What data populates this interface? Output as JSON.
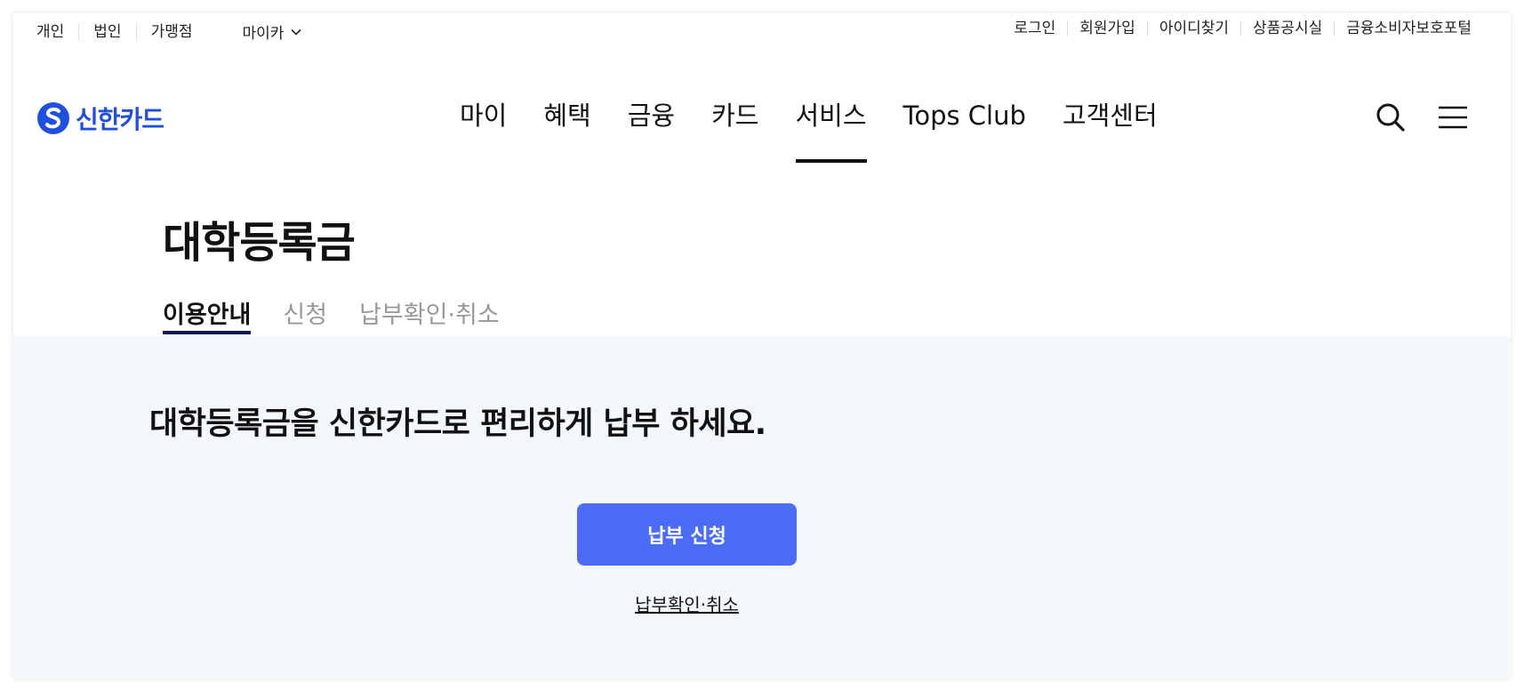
{
  "util": {
    "left": [
      "개인",
      "법인",
      "가맹점"
    ],
    "mycar": "마이카",
    "right": [
      "로그인",
      "회원가입",
      "아이디찾기",
      "상품공시실",
      "금융소비자보호포털"
    ]
  },
  "logo": {
    "text": "신한카드"
  },
  "nav": {
    "items": [
      "마이",
      "혜택",
      "금융",
      "카드",
      "서비스",
      "Tops Club",
      "고객센터"
    ],
    "active": "서비스"
  },
  "page": {
    "title": "대학등록금"
  },
  "tabs": [
    "이용안내",
    "신청",
    "납부확인·취소"
  ],
  "content": {
    "headline": "대학등록금을 신한카드로 편리하게 납부 하세요.",
    "apply_button": "납부 신청",
    "confirm_link": "납부확인·취소"
  },
  "colors": {
    "brand": "#1f4fe0",
    "button": "#4a6cf7",
    "panel_bg": "#f4f7fb",
    "tab_underline": "#0c1a52"
  },
  "icons": [
    "chevron-down-icon",
    "shinhan-logo-icon",
    "search-icon",
    "hamburger-menu-icon"
  ]
}
